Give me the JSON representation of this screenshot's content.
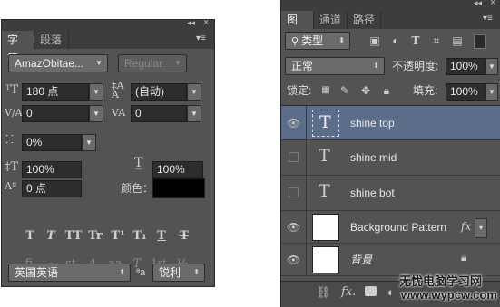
{
  "character_panel": {
    "collapse_glyph": "◂◂",
    "close_glyph": "×",
    "tabs": [
      {
        "label": "字符"
      },
      {
        "label": "段落"
      }
    ],
    "menu_glyph": "▾≡",
    "font_family": "AmazObitae...",
    "font_style": "Regular",
    "font_size": "180 点",
    "leading": "(自动)",
    "kerning": "0",
    "tracking": "0",
    "scale_percent": "0%",
    "vertical_scale": "100%",
    "horizontal_scale": "100%",
    "baseline_shift": "0 点",
    "color_label": "颜色：",
    "color_value": "#000000",
    "style_buttons": [
      "T",
      "T",
      "TT",
      "Tr",
      "T¹",
      "T₁",
      "T",
      "T"
    ],
    "opentype_buttons": [
      "ﬁ",
      "ℴ",
      "st",
      "A",
      "aa",
      "T",
      "1st",
      "½"
    ],
    "language": "英国英语",
    "aa_label": "ªa",
    "antialias": "锐利"
  },
  "layers_panel": {
    "collapse_glyph": "◂◂",
    "close_glyph": "×",
    "tabs": [
      {
        "label": "图层"
      },
      {
        "label": "通道"
      },
      {
        "label": "路径"
      }
    ],
    "menu_glyph": "▾≡",
    "filter_label": "类型",
    "blend_mode": "正常",
    "opacity_label": "不透明度:",
    "opacity_value": "100%",
    "lock_label": "锁定:",
    "fill_label": "填充:",
    "fill_value": "100%",
    "layers": [
      {
        "name": "shine top",
        "type": "text",
        "visible": true,
        "selected": true
      },
      {
        "name": "shine mid",
        "type": "text",
        "visible": false,
        "selected": false
      },
      {
        "name": "shine  bot",
        "type": "text",
        "visible": false,
        "selected": false
      },
      {
        "name": "Background Pattern",
        "type": "image",
        "visible": true,
        "selected": false,
        "fx": "fx"
      },
      {
        "name": "背景",
        "type": "image",
        "visible": true,
        "selected": false,
        "locked": true
      }
    ],
    "bottom_icons": [
      "link-icon",
      "fx-icon",
      "mask-icon",
      "adjustment-icon"
    ],
    "fx_text": "fx."
  },
  "watermark": {
    "line1": "无忧电脑学习网",
    "line2": "www.wypcw.com"
  },
  "accent_selected": "#5b6e89"
}
